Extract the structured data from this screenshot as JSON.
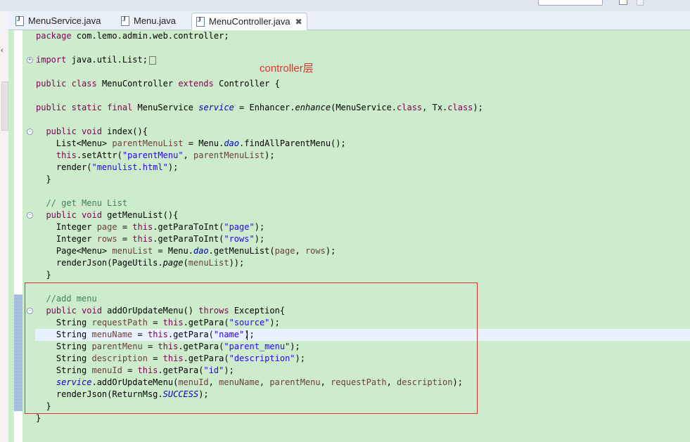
{
  "tabs": [
    {
      "label": "MenuService.java",
      "active": false
    },
    {
      "label": "Menu.java",
      "active": false
    },
    {
      "label": "MenuController.java",
      "active": true
    }
  ],
  "annotation": "controller层",
  "code": {
    "l1": [
      "package",
      " com.lemo.admin.web.controller;"
    ],
    "l2": [
      "import",
      " java.util.List;"
    ],
    "l3": [
      "public",
      " ",
      "class",
      " MenuController ",
      "extends",
      " Controller {"
    ],
    "l4": [
      "public",
      " ",
      "static",
      " ",
      "final",
      " MenuService ",
      "service",
      " = Enhancer.",
      "enhance",
      "(MenuService.",
      "class",
      ", Tx.",
      "class",
      ");"
    ],
    "l5": [
      "  ",
      "public",
      " ",
      "void",
      " index(){"
    ],
    "l6": [
      "    List<Menu> ",
      "parentMenuList",
      " = Menu.",
      "dao",
      ".findAllParentMenu();"
    ],
    "l7": [
      "    ",
      "this",
      ".setAttr(",
      "\"parentMenu\"",
      ", ",
      "parentMenuList",
      ");"
    ],
    "l8": [
      "    render(",
      "\"menulist.html\"",
      ");"
    ],
    "l9": [
      "  }"
    ],
    "l10": [
      "  // get Menu List"
    ],
    "l11": [
      "  ",
      "public",
      " ",
      "void",
      " getMenuList(){"
    ],
    "l12": [
      "    Integer ",
      "page",
      " = ",
      "this",
      ".getParaToInt(",
      "\"page\"",
      ");"
    ],
    "l13": [
      "    Integer ",
      "rows",
      " = ",
      "this",
      ".getParaToInt(",
      "\"rows\"",
      ");"
    ],
    "l14": [
      "    Page<Menu> ",
      "menuList",
      " = Menu.",
      "dao",
      ".getMenuList(",
      "page",
      ", ",
      "rows",
      ");"
    ],
    "l15": [
      "    renderJson(PageUtils.",
      "page",
      "(",
      "menuList",
      "));"
    ],
    "l16": [
      "  }"
    ],
    "l17": [
      "  //add menu"
    ],
    "l18": [
      "  ",
      "public",
      " ",
      "void",
      " addOrUpdateMenu() ",
      "throws",
      " Exception{"
    ],
    "l19": [
      "    String ",
      "requestPath",
      " = ",
      "this",
      ".getPara(",
      "\"source\"",
      ");"
    ],
    "l20": [
      "    String ",
      "menuName",
      " = ",
      "this",
      ".getPara(",
      "\"name\"",
      ");"
    ],
    "l21": [
      "    String ",
      "parentMenu",
      " = ",
      "this",
      ".getPara(",
      "\"parent_menu\"",
      ");"
    ],
    "l22": [
      "    String ",
      "description",
      " = ",
      "this",
      ".getPara(",
      "\"description\"",
      ");"
    ],
    "l23": [
      "    String ",
      "menuId",
      " = ",
      "this",
      ".getPara(",
      "\"id\"",
      ");"
    ],
    "l24": [
      "    ",
      "service",
      ".addOrUpdateMenu(",
      "menuId",
      ", ",
      "menuName",
      ", ",
      "parentMenu",
      ", ",
      "requestPath",
      ", ",
      "description",
      ");"
    ],
    "l25": [
      "    renderJson(ReturnMsg.",
      "SUCCESS",
      ");"
    ],
    "l26": [
      "  }"
    ],
    "l27": [
      "}"
    ]
  },
  "colors": {
    "editor_bg": "#cceccc",
    "keyword": "#7f0055",
    "string": "#2a00ff",
    "comment": "#3f7f5f",
    "field": "#0000c0",
    "annotation": "#e53030"
  }
}
